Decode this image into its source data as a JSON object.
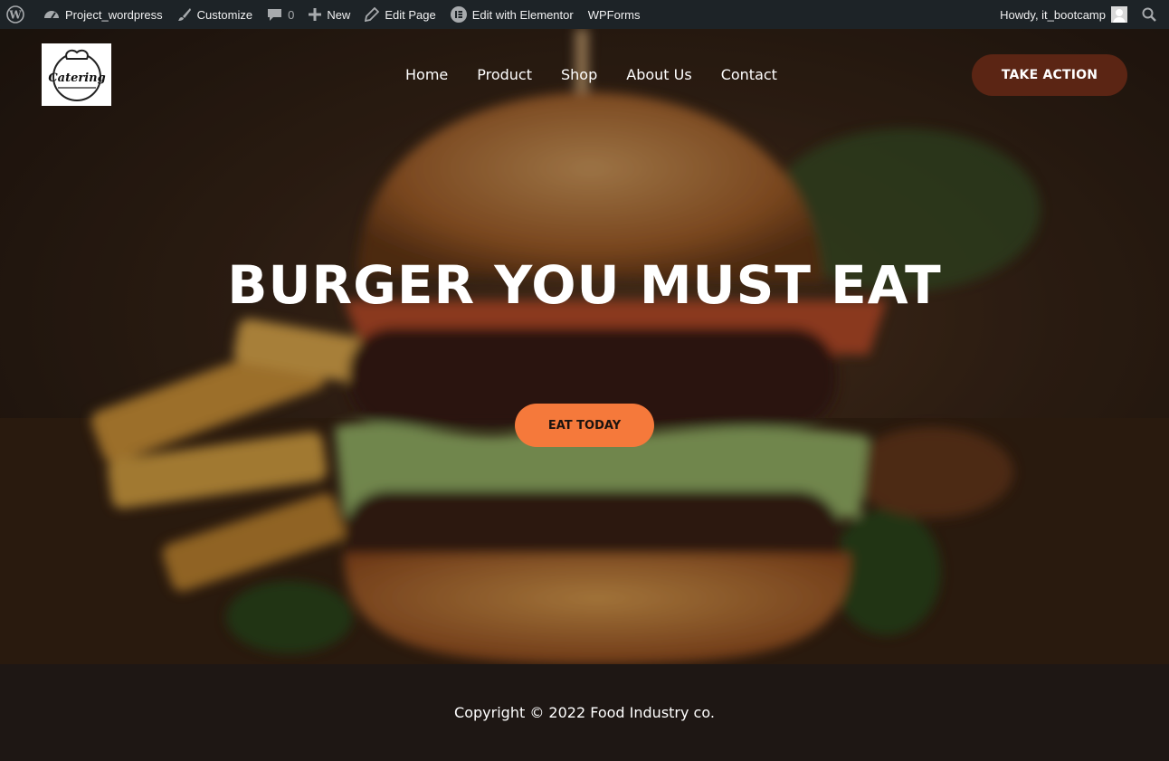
{
  "admin_bar": {
    "site_name": "Project_wordpress",
    "customize": "Customize",
    "comments_count": "0",
    "new": "New",
    "edit_page": "Edit Page",
    "edit_elementor": "Edit with Elementor",
    "wpforms": "WPForms",
    "howdy": "Howdy, it_bootcamp"
  },
  "header": {
    "logo_text": "Catering",
    "nav": [
      "Home",
      "Product",
      "Shop",
      "About Us",
      "Contact"
    ],
    "cta_label": "TAKE ACTION"
  },
  "hero": {
    "headline": "BURGER YOU MUST EAT",
    "cta_label": "EAT TODAY"
  },
  "footer": {
    "copyright": "Copyright © 2022 Food Industry co."
  },
  "colors": {
    "admin_bar": "#1d2327",
    "take_action": "#5b2514",
    "eat_today": "#f5793b",
    "footer": "#1e1714"
  }
}
